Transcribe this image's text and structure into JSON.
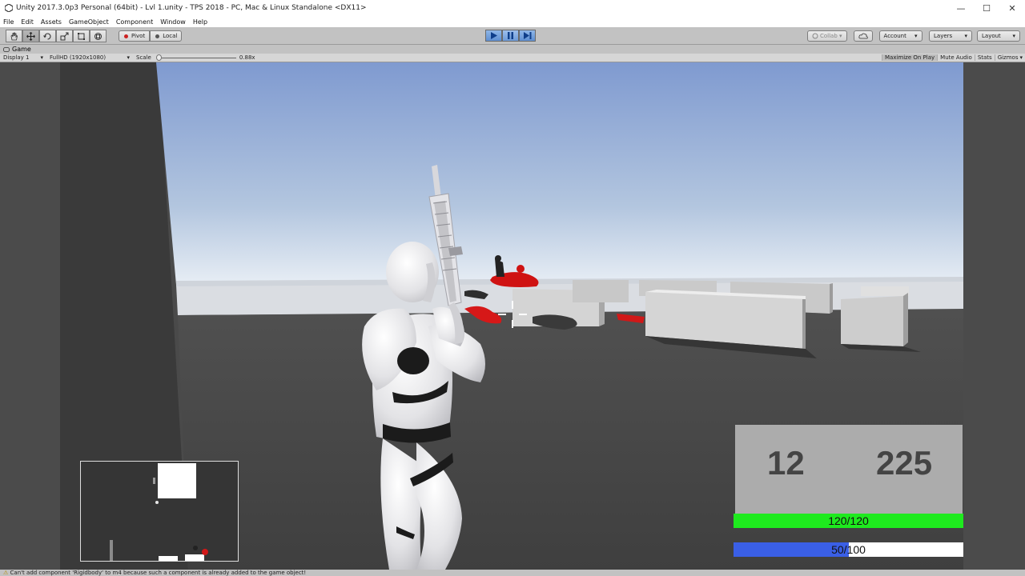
{
  "window": {
    "title": "Unity 2017.3.0p3 Personal (64bit) - Lvl 1.unity - TPS 2018 - PC, Mac & Linux Standalone <DX11>",
    "controls": [
      "—",
      "☐",
      "✕"
    ]
  },
  "menu": [
    "File",
    "Edit",
    "Assets",
    "GameObject",
    "Component",
    "Window",
    "Help"
  ],
  "toolbar": {
    "pivot_label": "Pivot",
    "local_label": "Local",
    "collab_label": "Collab ▾",
    "account_label": "Account",
    "layers_label": "Layers",
    "layout_label": "Layout"
  },
  "game_view": {
    "tab_label": "Game",
    "display_label": "Display 1",
    "resolution_label": "FullHD (1920x1080)",
    "scale_label": "Scale",
    "scale_value": "0.88x",
    "maximize_label": "Maximize On Play",
    "mute_label": "Mute Audio",
    "stats_label": "Stats",
    "gizmos_label": "Gizmos"
  },
  "hud": {
    "ammo_clip": "12",
    "ammo_total": "225",
    "health_text": "120/120",
    "health_fraction": 1.0,
    "health_color": "#1eea1e",
    "stamina_text": "50/100",
    "stamina_fraction": 0.5,
    "stamina_color": "#3a5fe6"
  },
  "status": {
    "message": "Can't add component 'Rigidbody' to m4 because such a component is already added to the game object!"
  }
}
